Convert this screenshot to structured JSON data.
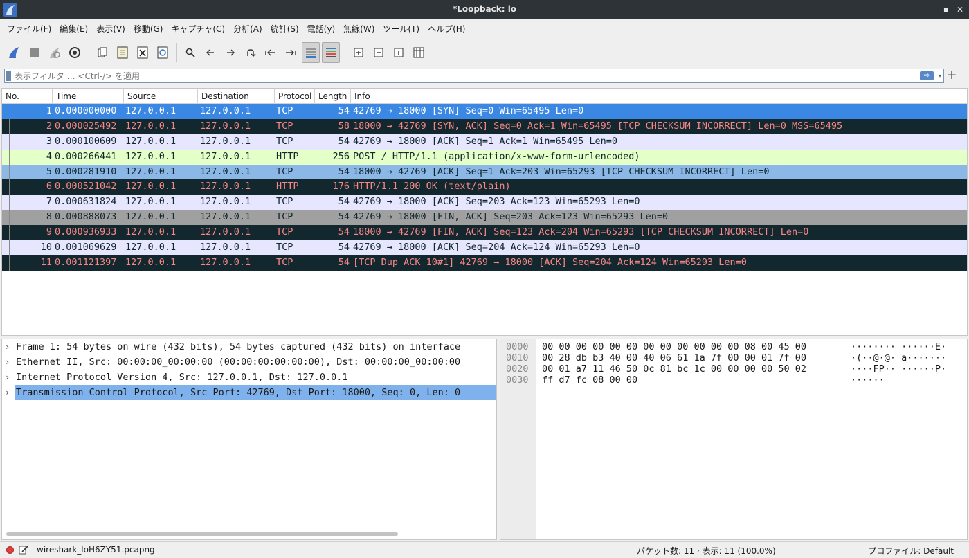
{
  "window": {
    "title": "*Loopback: lo"
  },
  "menu": [
    "ファイル(F)",
    "編集(E)",
    "表示(V)",
    "移動(G)",
    "キャプチャ(C)",
    "分析(A)",
    "統計(S)",
    "電話(y)",
    "無線(W)",
    "ツール(T)",
    "ヘルプ(H)"
  ],
  "filter": {
    "placeholder": "表示フィルタ … <Ctrl-/> を適用",
    "value": ""
  },
  "columns": [
    "No.",
    "Time",
    "Source",
    "Destination",
    "Protocol",
    "Length",
    "Info"
  ],
  "packets": [
    {
      "no": "1",
      "time": "0.000000000",
      "src": "127.0.0.1",
      "dst": "127.0.0.1",
      "proto": "TCP",
      "len": "54",
      "info": "42769 → 18000 [SYN] Seq=0 Win=65495 Len=0",
      "bg": "#3a87e4",
      "fg": "#ffffff"
    },
    {
      "no": "2",
      "time": "0.000025492",
      "src": "127.0.0.1",
      "dst": "127.0.0.1",
      "proto": "TCP",
      "len": "58",
      "info": "18000 → 42769 [SYN, ACK] Seq=0 Ack=1 Win=65495 [TCP CHECKSUM INCORRECT] Len=0 MSS=65495",
      "bg": "#12272e",
      "fg": "#f78787"
    },
    {
      "no": "3",
      "time": "0.000100609",
      "src": "127.0.0.1",
      "dst": "127.0.0.1",
      "proto": "TCP",
      "len": "54",
      "info": "42769 → 18000 [ACK] Seq=1 Ack=1 Win=65495 Len=0",
      "bg": "#e7e6ff",
      "fg": "#12272e"
    },
    {
      "no": "4",
      "time": "0.000266441",
      "src": "127.0.0.1",
      "dst": "127.0.0.1",
      "proto": "HTTP",
      "len": "256",
      "info": "POST / HTTP/1.1  (application/x-www-form-urlencoded)",
      "bg": "#e4ffc7",
      "fg": "#12272e"
    },
    {
      "no": "5",
      "time": "0.000281910",
      "src": "127.0.0.1",
      "dst": "127.0.0.1",
      "proto": "TCP",
      "len": "54",
      "info": "18000 → 42769 [ACK] Seq=1 Ack=203 Win=65293 [TCP CHECKSUM INCORRECT] Len=0",
      "bg": "#8cb8e8",
      "fg": "#12272e"
    },
    {
      "no": "6",
      "time": "0.000521042",
      "src": "127.0.0.1",
      "dst": "127.0.0.1",
      "proto": "HTTP",
      "len": "176",
      "info": "HTTP/1.1 200 OK  (text/plain)",
      "bg": "#12272e",
      "fg": "#f78787"
    },
    {
      "no": "7",
      "time": "0.000631824",
      "src": "127.0.0.1",
      "dst": "127.0.0.1",
      "proto": "TCP",
      "len": "54",
      "info": "42769 → 18000 [ACK] Seq=203 Ack=123 Win=65293 Len=0",
      "bg": "#e7e6ff",
      "fg": "#12272e"
    },
    {
      "no": "8",
      "time": "0.000888073",
      "src": "127.0.0.1",
      "dst": "127.0.0.1",
      "proto": "TCP",
      "len": "54",
      "info": "42769 → 18000 [FIN, ACK] Seq=203 Ack=123 Win=65293 Len=0",
      "bg": "#a0a0a0",
      "fg": "#12272e"
    },
    {
      "no": "9",
      "time": "0.000936933",
      "src": "127.0.0.1",
      "dst": "127.0.0.1",
      "proto": "TCP",
      "len": "54",
      "info": "18000 → 42769 [FIN, ACK] Seq=123 Ack=204 Win=65293 [TCP CHECKSUM INCORRECT] Len=0",
      "bg": "#12272e",
      "fg": "#f78787"
    },
    {
      "no": "10",
      "time": "0.001069629",
      "src": "127.0.0.1",
      "dst": "127.0.0.1",
      "proto": "TCP",
      "len": "54",
      "info": "42769 → 18000 [ACK] Seq=204 Ack=124 Win=65293 Len=0",
      "bg": "#e7e6ff",
      "fg": "#12272e"
    },
    {
      "no": "11",
      "time": "0.001121397",
      "src": "127.0.0.1",
      "dst": "127.0.0.1",
      "proto": "TCP",
      "len": "54",
      "info": "[TCP Dup ACK 10#1] 42769 → 18000 [ACK] Seq=204 Ack=124 Win=65293 Len=0",
      "bg": "#12272e",
      "fg": "#f78787"
    }
  ],
  "details": [
    {
      "text": "Frame 1: 54 bytes on wire (432 bits), 54 bytes captured (432 bits) on interface",
      "selected": false
    },
    {
      "text": "Ethernet II, Src: 00:00:00_00:00:00 (00:00:00:00:00:00), Dst: 00:00:00_00:00:00",
      "selected": false
    },
    {
      "text": "Internet Protocol Version 4, Src: 127.0.0.1, Dst: 127.0.0.1",
      "selected": false
    },
    {
      "text": "Transmission Control Protocol, Src Port: 42769, Dst Port: 18000, Seq: 0, Len: 0",
      "selected": true
    }
  ],
  "bytes": [
    {
      "offset": "0000",
      "hex": "00 00 00 00 00 00 00 00  00 00 00 00 08 00 45 00",
      "ascii": "········ ······E·"
    },
    {
      "offset": "0010",
      "hex": "00 28 db b3 40 00 40 06  61 1a 7f 00 00 01 7f 00",
      "ascii": "·(··@·@· a·······"
    },
    {
      "offset": "0020",
      "hex": "00 01 a7 11 46 50 0c 81  bc 1c 00 00 00 00 50 02",
      "ascii": "····FP·· ······P·"
    },
    {
      "offset": "0030",
      "hex": "ff d7 fc 08 00 00",
      "ascii": "······"
    }
  ],
  "status": {
    "file": "wireshark_loH6ZY51.pcapng",
    "packets": "パケット数: 11 · 表示: 11 (100.0%)",
    "profile": "プロファイル: Default"
  }
}
